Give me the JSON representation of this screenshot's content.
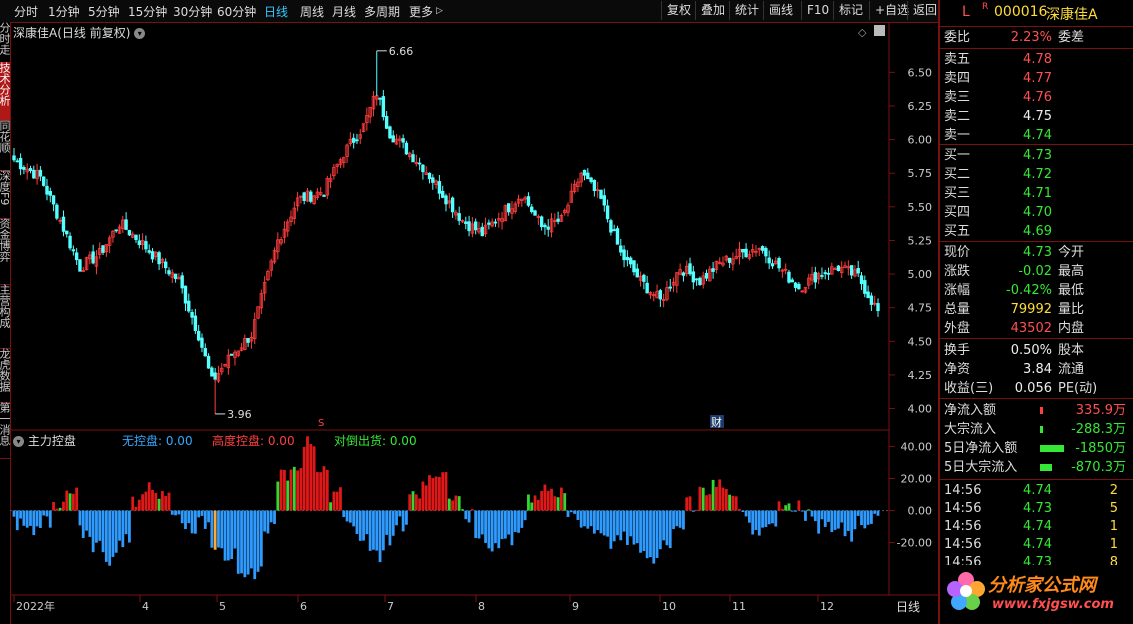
{
  "toolbar": {
    "periods": [
      {
        "label": "分时"
      },
      {
        "label": "1分钟"
      },
      {
        "label": "5分钟"
      },
      {
        "label": "15分钟"
      },
      {
        "label": "30分钟"
      },
      {
        "label": "60分钟"
      },
      {
        "label": "日线"
      },
      {
        "label": "周线"
      },
      {
        "label": "月线"
      },
      {
        "label": "多周期"
      },
      {
        "label": "更多"
      }
    ],
    "more_arrow": "▷",
    "buttons": [
      {
        "label": "复权"
      },
      {
        "label": "叠加"
      },
      {
        "label": "统计"
      },
      {
        "label": "画线"
      },
      {
        "label": "F10"
      },
      {
        "label": "标记"
      },
      {
        "label": "+自选"
      },
      {
        "label": "返回"
      }
    ]
  },
  "sidebar": {
    "tabs": [
      {
        "label": "分时走势"
      },
      {
        "label": "技术分析"
      },
      {
        "label": "同花顺"
      },
      {
        "label": "深度F9"
      },
      {
        "label": "资金博弈"
      },
      {
        "label": "主营构成"
      },
      {
        "label": "龙虎数据"
      },
      {
        "label": "第一消息"
      }
    ]
  },
  "chart": {
    "title": "深康佳A",
    "title_suffix": "(日线 前复权)",
    "max_label": "6.66",
    "min_label": "3.96",
    "marker_s": "S",
    "marker_cai": "财",
    "price_ticks": [
      "6.50",
      "6.25",
      "6.00",
      "5.75",
      "5.50",
      "5.25",
      "5.00",
      "4.75",
      "4.50",
      "4.25",
      "4.00"
    ],
    "price_range": [
      3.9,
      6.8
    ]
  },
  "indicator": {
    "name": "主力控盘",
    "items": [
      {
        "label": "无控盘: 0.00",
        "color": "#35a8ff"
      },
      {
        "label": "高度控盘: 0.00",
        "color": "#ff4040"
      },
      {
        "label": "对倒出货: 0.00",
        "color": "#35e835"
      }
    ],
    "ticks": [
      "40.00",
      "20.00",
      "0.00",
      "-20.00"
    ],
    "range": [
      -52,
      44
    ]
  },
  "xaxis": {
    "labels": [
      "2022年",
      "4",
      "5",
      "6",
      "7",
      "8",
      "9",
      "10",
      "11",
      "12"
    ],
    "period_badge": "日线"
  },
  "panel": {
    "market": "L",
    "market_sup": "R",
    "code": "000016",
    "name": "深康佳A",
    "weibi_label": "委比",
    "weibi_value": "2.23%",
    "weicha_label": "委差",
    "asks": [
      {
        "label": "卖五",
        "price": "4.78",
        "cls": "up"
      },
      {
        "label": "卖四",
        "price": "4.77",
        "cls": "up"
      },
      {
        "label": "卖三",
        "price": "4.76",
        "cls": "up"
      },
      {
        "label": "卖二",
        "price": "4.75",
        "cls": "white"
      },
      {
        "label": "卖一",
        "price": "4.74",
        "cls": "down"
      }
    ],
    "bids": [
      {
        "label": "买一",
        "price": "4.73",
        "cls": "down"
      },
      {
        "label": "买二",
        "price": "4.72",
        "cls": "down"
      },
      {
        "label": "买三",
        "price": "4.71",
        "cls": "down"
      },
      {
        "label": "买四",
        "price": "4.70",
        "cls": "down"
      },
      {
        "label": "买五",
        "price": "4.69",
        "cls": "down"
      }
    ],
    "quote": [
      {
        "label": "现价",
        "value": "4.73",
        "cls": "down",
        "right": "今开"
      },
      {
        "label": "涨跌",
        "value": "-0.02",
        "cls": "down",
        "right": "最高"
      },
      {
        "label": "涨幅",
        "value": "-0.42%",
        "cls": "down",
        "right": "最低"
      },
      {
        "label": "总量",
        "value": "79992",
        "cls": "yellow",
        "right": "量比"
      },
      {
        "label": "外盘",
        "value": "43502",
        "cls": "up",
        "right": "内盘"
      }
    ],
    "fund": [
      {
        "label": "换手",
        "value": "0.50%",
        "cls": "white",
        "right": "股本"
      },
      {
        "label": "净资",
        "value": "3.84",
        "cls": "white",
        "right": "流通"
      },
      {
        "label": "收益(三)",
        "value": "0.056",
        "cls": "white",
        "right": "PE(动)"
      }
    ],
    "flows": [
      {
        "label": "净流入额",
        "value": "335.9万",
        "cls": "up",
        "bar": "#ff4040",
        "frac": 0.02
      },
      {
        "label": "大宗流入",
        "value": "-288.3万",
        "cls": "down",
        "bar": "#35e835",
        "frac": 0.02
      },
      {
        "label": "5日净流入额",
        "value": "-1850万",
        "cls": "down",
        "bar": "#35e835",
        "frac": 0.4
      },
      {
        "label": "5日大宗流入",
        "value": "-870.3万",
        "cls": "down",
        "bar": "#35e835",
        "frac": 0.2
      }
    ],
    "ticks": [
      {
        "time": "14:56",
        "price": "4.74",
        "vol": "2"
      },
      {
        "time": "14:56",
        "price": "4.73",
        "vol": "5"
      },
      {
        "time": "14:56",
        "price": "4.74",
        "vol": "1"
      },
      {
        "time": "14:56",
        "price": "4.74",
        "vol": "1"
      },
      {
        "time": "14:56",
        "price": "4.73",
        "vol": "8"
      }
    ],
    "logo_text": "分析家公式网",
    "logo_url": "www.fxjgsw.com"
  },
  "chart_data": {
    "type": "candlestick",
    "key_points": [
      {
        "i": 0,
        "p": 5.85
      },
      {
        "i": 8,
        "p": 5.72
      },
      {
        "i": 14,
        "p": 5.4
      },
      {
        "i": 20,
        "p": 5.05
      },
      {
        "i": 26,
        "p": 5.15
      },
      {
        "i": 32,
        "p": 5.38
      },
      {
        "i": 38,
        "p": 5.25
      },
      {
        "i": 44,
        "p": 5.1
      },
      {
        "i": 50,
        "p": 4.95
      },
      {
        "i": 56,
        "p": 4.55
      },
      {
        "i": 60,
        "p": 4.2
      },
      {
        "i": 66,
        "p": 4.4
      },
      {
        "i": 72,
        "p": 4.55
      },
      {
        "i": 80,
        "p": 5.25
      },
      {
        "i": 86,
        "p": 5.55
      },
      {
        "i": 94,
        "p": 5.62
      },
      {
        "i": 100,
        "p": 5.9
      },
      {
        "i": 106,
        "p": 6.1
      },
      {
        "i": 110,
        "p": 6.35
      },
      {
        "i": 114,
        "p": 6.05
      },
      {
        "i": 118,
        "p": 5.95
      },
      {
        "i": 124,
        "p": 5.8
      },
      {
        "i": 130,
        "p": 5.6
      },
      {
        "i": 136,
        "p": 5.4
      },
      {
        "i": 142,
        "p": 5.3
      },
      {
        "i": 148,
        "p": 5.45
      },
      {
        "i": 154,
        "p": 5.6
      },
      {
        "i": 160,
        "p": 5.35
      },
      {
        "i": 166,
        "p": 5.4
      },
      {
        "i": 172,
        "p": 5.75
      },
      {
        "i": 178,
        "p": 5.55
      },
      {
        "i": 184,
        "p": 5.15
      },
      {
        "i": 190,
        "p": 4.95
      },
      {
        "i": 196,
        "p": 4.8
      },
      {
        "i": 202,
        "p": 5.05
      },
      {
        "i": 208,
        "p": 4.95
      },
      {
        "i": 214,
        "p": 5.08
      },
      {
        "i": 220,
        "p": 5.15
      },
      {
        "i": 226,
        "p": 5.2
      },
      {
        "i": 232,
        "p": 5.05
      },
      {
        "i": 238,
        "p": 4.9
      },
      {
        "i": 244,
        "p": 5.0
      },
      {
        "i": 250,
        "p": 5.05
      },
      {
        "i": 256,
        "p": 4.98
      },
      {
        "i": 262,
        "p": 4.72
      }
    ],
    "bars": 263,
    "osc_pattern": [
      -8,
      -12,
      -6,
      4,
      10,
      -14,
      -22,
      -30,
      -18,
      6,
      14,
      12,
      -4,
      -10,
      -8,
      -20,
      -28,
      -44,
      -38,
      -10,
      22,
      30,
      42,
      26,
      10,
      -6,
      -14,
      -28,
      -20,
      -8,
      12,
      18,
      24,
      10,
      -4,
      -16,
      -22,
      -18,
      -10,
      8,
      16,
      10,
      -2,
      -10,
      -12,
      -20,
      -18,
      -24,
      -30,
      -20,
      -8,
      4,
      14,
      18,
      10,
      -4,
      -12,
      -8,
      6,
      4,
      -2,
      -10,
      -12,
      -16,
      -8,
      -4
    ]
  }
}
